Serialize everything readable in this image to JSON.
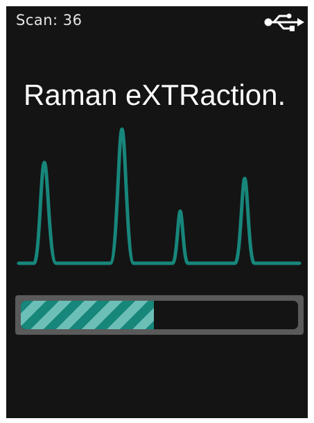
{
  "status_bar": {
    "scan_text": "Scan: 36",
    "connection_icon": "usb-icon"
  },
  "main": {
    "title": "Raman eXTRaction."
  },
  "spectrum": {
    "icon": "raman-spectrum-graphic",
    "peak_count": 4
  },
  "progress": {
    "fraction": 0.48
  },
  "colors": {
    "background": "#141414",
    "accent": "#17867b",
    "accent_light": "#6cbfb6",
    "frame": "#5a5a5a",
    "text": "#ffffff"
  }
}
